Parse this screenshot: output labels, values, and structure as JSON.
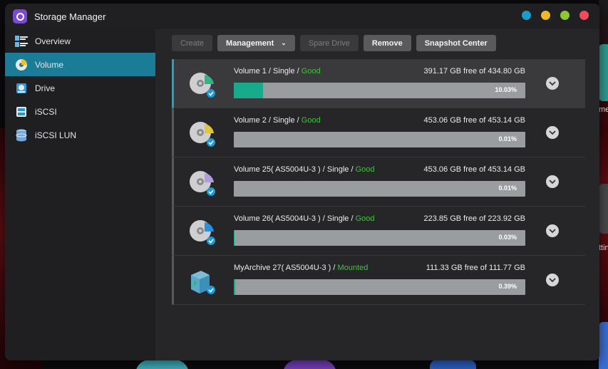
{
  "app": {
    "title": "Storage Manager"
  },
  "window_buttons": [
    {
      "name": "info",
      "color": "#1a9dc9"
    },
    {
      "name": "minimize",
      "color": "#f1b927"
    },
    {
      "name": "maximize",
      "color": "#8cc631"
    },
    {
      "name": "close",
      "color": "#f24a59"
    }
  ],
  "sidebar": {
    "items": [
      {
        "label": "Overview",
        "icon": "overview-icon",
        "active": false
      },
      {
        "label": "Volume",
        "icon": "volume-icon",
        "active": true
      },
      {
        "label": "Drive",
        "icon": "drive-icon",
        "active": false
      },
      {
        "label": "iSCSI",
        "icon": "iscsi-icon",
        "active": false
      },
      {
        "label": "iSCSI LUN",
        "icon": "iscsi-lun-icon",
        "active": false
      }
    ]
  },
  "toolbar": {
    "create": "Create",
    "management": "Management",
    "spare_drive": "Spare Drive",
    "remove": "Remove",
    "snapshot_center": "Snapshot Center"
  },
  "volumes": [
    {
      "name": "Volume 1 / Single / ",
      "status": "Good",
      "free": "391.17 GB free of 434.80 GB",
      "percent": "10.03%",
      "usage": 0.1003,
      "icon_color": "#2fb57f",
      "selected": true
    },
    {
      "name": "Volume 2 / Single / ",
      "status": "Good",
      "free": "453.06 GB free of 453.14 GB",
      "percent": "0.01%",
      "usage": 0.0001,
      "icon_color": "#e2c53a",
      "selected": false
    },
    {
      "name": "Volume 25( AS5004U-3 ) / Single / ",
      "status": "Good",
      "free": "453.06 GB free of 453.14 GB",
      "percent": "0.01%",
      "usage": 0.0001,
      "icon_color": "#b39be0",
      "selected": false
    },
    {
      "name": "Volume 26( AS5004U-3 ) / Single / ",
      "status": "Good",
      "free": "223.85 GB free of 223.92 GB",
      "percent": "0.03%",
      "usage": 0.0003,
      "icon_color": "#2a8fe0",
      "selected": false
    },
    {
      "name": "MyArchive 27( AS5004U-3 ) / ",
      "status": "Mounted",
      "free": "111.33 GB free of 111.77 GB",
      "percent": "0.39%",
      "usage": 0.0039,
      "icon_color": "#2fa8c4",
      "selected": false
    }
  ],
  "colors": {
    "accent": "#1a7c96",
    "good": "#3dc43d",
    "usage_fill": "#17ab8c"
  }
}
